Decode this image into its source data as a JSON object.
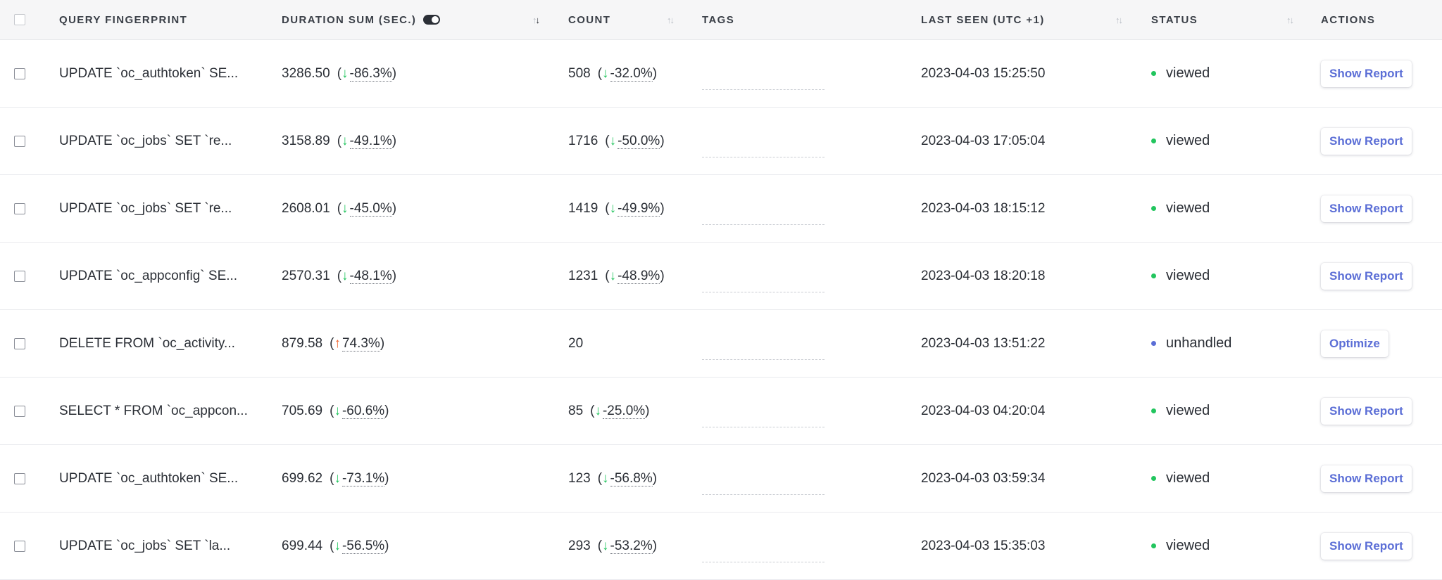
{
  "header": {
    "query_fingerprint": "QUERY FINGERPRINT",
    "duration_sum": "DURATION SUM (SEC.)",
    "count": "COUNT",
    "tags": "TAGS",
    "last_seen": "LAST SEEN (UTC +1)",
    "status": "STATUS",
    "actions": "ACTIONS"
  },
  "colors": {
    "down_arrow": "#22c55e",
    "up_arrow": "#f0642d",
    "viewed_dot": "#22c55e",
    "unhandled_dot": "#5b6ed6",
    "button_text": "#5b6ed6"
  },
  "rows": [
    {
      "query": "UPDATE `oc_authtoken` SE...",
      "duration": "3286.50",
      "duration_delta": "-86.3%",
      "duration_dir": "down",
      "count": "508",
      "count_delta": "-32.0%",
      "count_dir": "down",
      "last_seen": "2023-04-03 15:25:50",
      "status": "viewed",
      "action": "Show Report"
    },
    {
      "query": "UPDATE `oc_jobs` SET `re...",
      "duration": "3158.89",
      "duration_delta": "-49.1%",
      "duration_dir": "down",
      "count": "1716",
      "count_delta": "-50.0%",
      "count_dir": "down",
      "last_seen": "2023-04-03 17:05:04",
      "status": "viewed",
      "action": "Show Report"
    },
    {
      "query": "UPDATE `oc_jobs` SET `re...",
      "duration": "2608.01",
      "duration_delta": "-45.0%",
      "duration_dir": "down",
      "count": "1419",
      "count_delta": "-49.9%",
      "count_dir": "down",
      "last_seen": "2023-04-03 18:15:12",
      "status": "viewed",
      "action": "Show Report"
    },
    {
      "query": "UPDATE `oc_appconfig` SE...",
      "duration": "2570.31",
      "duration_delta": "-48.1%",
      "duration_dir": "down",
      "count": "1231",
      "count_delta": "-48.9%",
      "count_dir": "down",
      "last_seen": "2023-04-03 18:20:18",
      "status": "viewed",
      "action": "Show Report"
    },
    {
      "query": "DELETE FROM `oc_activity...",
      "duration": "879.58",
      "duration_delta": "74.3%",
      "duration_dir": "up",
      "count": "20",
      "count_delta": "",
      "count_dir": "",
      "last_seen": "2023-04-03 13:51:22",
      "status": "unhandled",
      "action": "Optimize"
    },
    {
      "query": "SELECT * FROM `oc_appcon...",
      "duration": "705.69",
      "duration_delta": "-60.6%",
      "duration_dir": "down",
      "count": "85",
      "count_delta": "-25.0%",
      "count_dir": "down",
      "last_seen": "2023-04-03 04:20:04",
      "status": "viewed",
      "action": "Show Report"
    },
    {
      "query": "UPDATE `oc_authtoken` SE...",
      "duration": "699.62",
      "duration_delta": "-73.1%",
      "duration_dir": "down",
      "count": "123",
      "count_delta": "-56.8%",
      "count_dir": "down",
      "last_seen": "2023-04-03 03:59:34",
      "status": "viewed",
      "action": "Show Report"
    },
    {
      "query": "UPDATE `oc_jobs` SET `la...",
      "duration": "699.44",
      "duration_delta": "-56.5%",
      "duration_dir": "down",
      "count": "293",
      "count_delta": "-53.2%",
      "count_dir": "down",
      "last_seen": "2023-04-03 15:35:03",
      "status": "viewed",
      "action": "Show Report"
    }
  ]
}
